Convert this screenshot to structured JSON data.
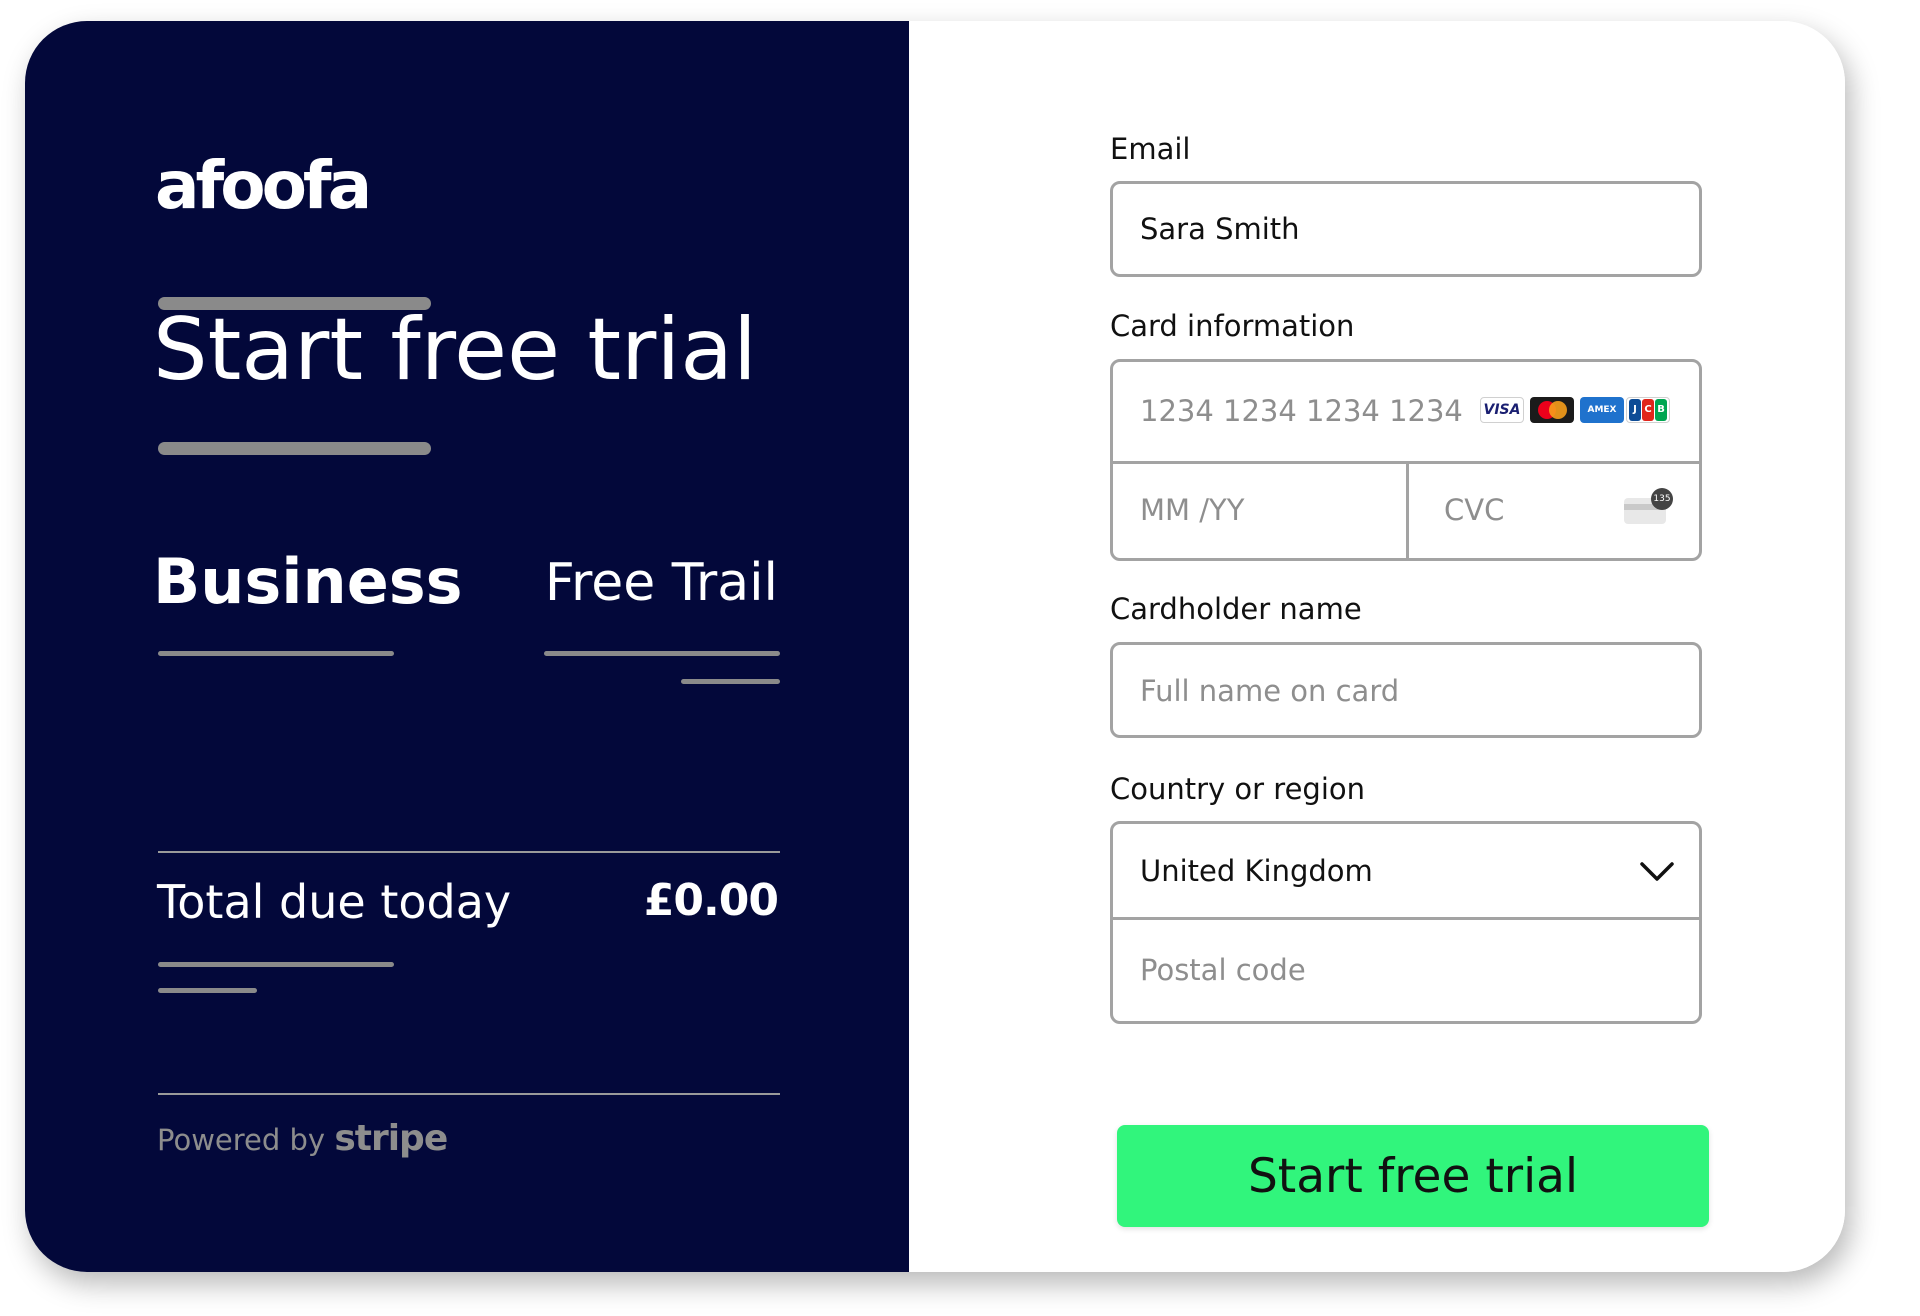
{
  "brand": {
    "logo_text": "afoofa"
  },
  "summary": {
    "title": "Start free trial",
    "plan_name": "Business",
    "plan_price": "Free Trail",
    "total_label": "Total due today",
    "total_value": "£0.00",
    "powered_by": "Powered by",
    "powered_brand": "stripe"
  },
  "form": {
    "email": {
      "label": "Email",
      "value": "Sara Smith"
    },
    "card": {
      "label": "Card information",
      "number_placeholder": "1234 1234 1234 1234",
      "expiry_placeholder": "MM /YY",
      "cvc_placeholder": "CVC",
      "brands": [
        "VISA",
        "mastercard",
        "AMEX",
        "JCB"
      ],
      "cvc_hint": "135"
    },
    "cardholder": {
      "label": "Cardholder name",
      "placeholder": "Full name on card"
    },
    "country": {
      "label": "Country or region",
      "value": "United Kingdom",
      "postal_placeholder": "Postal code"
    },
    "submit_label": "Start free trial"
  },
  "colors": {
    "panel": "#03083a",
    "button": "#31f57c",
    "border": "#a3a3a3",
    "placeholder": "#8e8e8e"
  }
}
